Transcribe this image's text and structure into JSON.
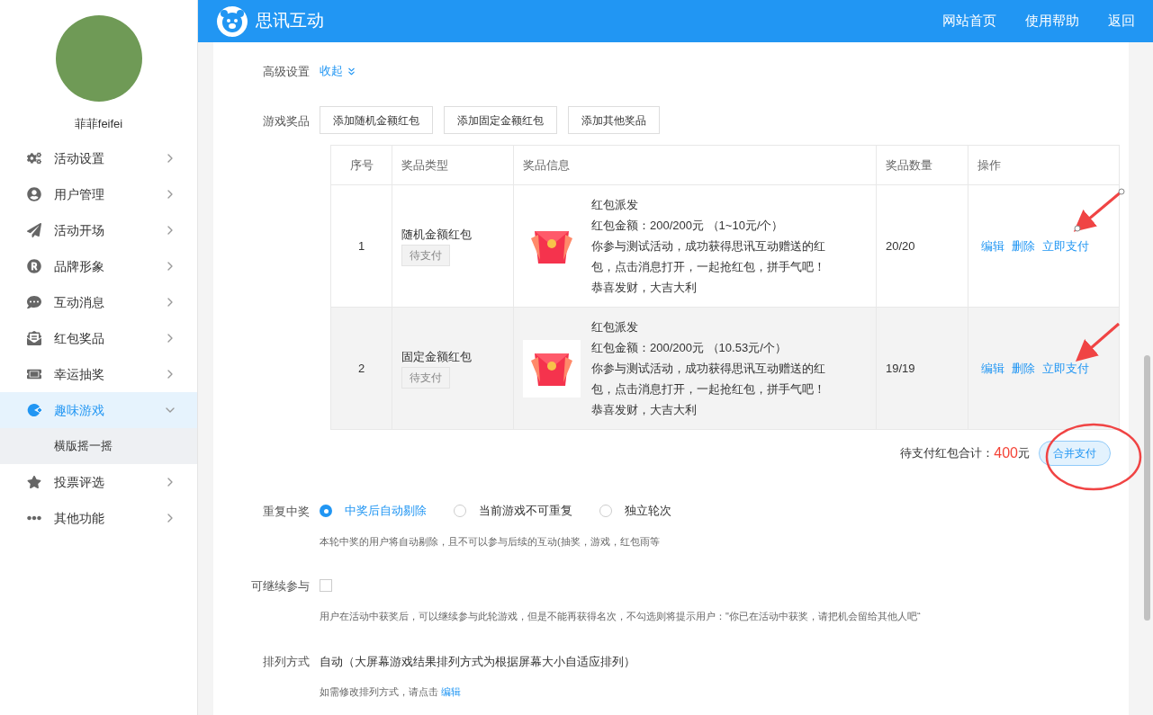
{
  "header": {
    "brand": "思讯互动",
    "links": [
      "网站首页",
      "使用帮助",
      "返回"
    ]
  },
  "sidebar": {
    "user_name": "菲菲feifei",
    "menu": [
      {
        "label": "活动设置",
        "selected": false,
        "expanded": false
      },
      {
        "label": "用户管理",
        "selected": false,
        "expanded": false
      },
      {
        "label": "活动开场",
        "selected": false,
        "expanded": false
      },
      {
        "label": "品牌形象",
        "selected": false,
        "expanded": false
      },
      {
        "label": "互动消息",
        "selected": false,
        "expanded": false
      },
      {
        "label": "红包奖品",
        "selected": false,
        "expanded": false
      },
      {
        "label": "幸运抽奖",
        "selected": false,
        "expanded": false
      },
      {
        "label": "趣味游戏",
        "selected": true,
        "expanded": true,
        "children": [
          {
            "label": "横版摇一摇",
            "selected": true
          }
        ]
      },
      {
        "label": "投票评选",
        "selected": false,
        "expanded": false
      },
      {
        "label": "其他功能",
        "selected": false,
        "expanded": false
      }
    ]
  },
  "advanced": {
    "label": "高级设置",
    "toggle": "收起"
  },
  "prizes": {
    "label": "游戏奖品",
    "buttons": [
      "添加随机金额红包",
      "添加固定金额红包",
      "添加其他奖品"
    ],
    "table": {
      "columns": [
        "序号",
        "奖品类型",
        "奖品信息",
        "奖品数量",
        "操作"
      ],
      "rows": [
        {
          "index": "1",
          "type": "随机金额红包",
          "status": "待支付",
          "title": "红包派发",
          "amount": "红包金额：200/200元 （1~10元/个）",
          "message": "你参与测试活动，成功获得思讯互动赠送的红包，点击消息打开，一起抢红包，拼手气吧！",
          "blessing": "恭喜发财，大吉大利",
          "quantity": "20/20",
          "actions": [
            "编辑",
            "删除",
            "立即支付"
          ],
          "highlighted": false
        },
        {
          "index": "2",
          "type": "固定金额红包",
          "status": "待支付",
          "title": "红包派发",
          "amount": "红包金额：200/200元 （10.53元/个）",
          "message": "你参与测试活动，成功获得思讯互动赠送的红包，点击消息打开，一起抢红包，拼手气吧！",
          "blessing": "恭喜发财，大吉大利",
          "quantity": "19/19",
          "actions": [
            "编辑",
            "删除",
            "立即支付"
          ],
          "highlighted": true
        }
      ]
    },
    "total_label": "待支付红包合计：",
    "total_amount": "400",
    "total_unit": "元",
    "merge_button": "合并支付"
  },
  "repeat": {
    "label": "重复中奖",
    "options": [
      {
        "label": "中奖后自动剔除",
        "selected": true
      },
      {
        "label": "当前游戏不可重复",
        "selected": false
      },
      {
        "label": "独立轮次",
        "selected": false
      }
    ],
    "hint": "本轮中奖的用户将自动剔除，且不可以参与后续的互动(抽奖，游戏，红包雨等"
  },
  "continue": {
    "label": "可继续参与",
    "checked": false,
    "hint": "用户在活动中获奖后，可以继续参与此轮游戏，但是不能再获得名次，不勾选则将提示用户：\"你已在活动中获奖，请把机会留给其他人吧“"
  },
  "arrange": {
    "label": "排列方式",
    "value": "自动（大屏幕游戏结果排列方式为根据屏幕大小自适应排列）",
    "hint": "如需修改排列方式，请点击",
    "link": "编辑"
  }
}
